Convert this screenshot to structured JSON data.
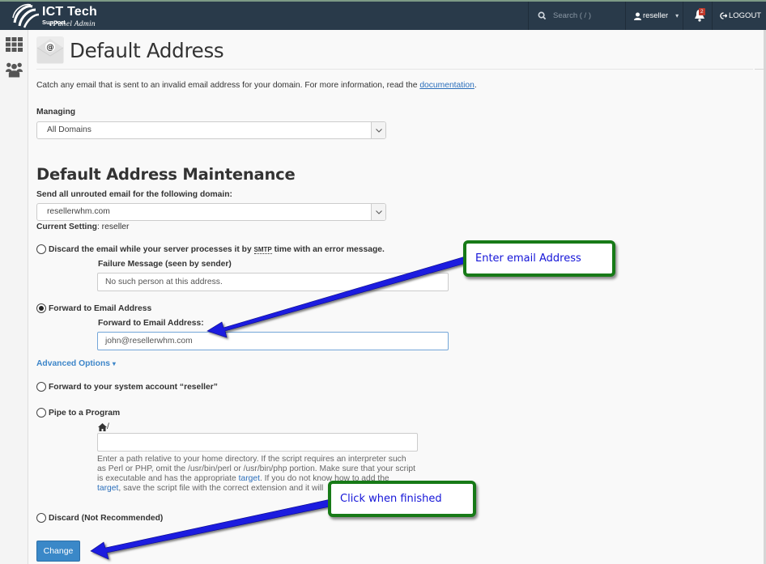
{
  "topbar": {
    "brand_main": "ICT Tech",
    "brand_sub": "Support",
    "brand_tag": "cPanel Admin",
    "search_placeholder": "Search ( / )",
    "username": "reseller",
    "notifications_count": "2",
    "logout_label": "LOGOUT"
  },
  "sidebar": {
    "items": [
      {
        "icon": "grid-icon",
        "label": "Home"
      },
      {
        "icon": "users-icon",
        "label": "Accounts"
      }
    ]
  },
  "page": {
    "title": "Default Address",
    "description_pre": "Catch any email that is sent to an invalid email address for your domain. For more information, read the ",
    "description_link": "documentation",
    "description_post": ".",
    "managing_label": "Managing",
    "managing_value": "All Domains",
    "section_title": "Default Address Maintenance",
    "domain_label": "Send all unrouted email for the following domain:",
    "domain_value": "resellerwhm.com",
    "current_setting_label": "Current Setting",
    "current_setting_value": ": reseller",
    "options": {
      "discard_pre": "Discard the email while your server processes it by ",
      "discard_abbr": "SMTP",
      "discard_post": " time with an error message.",
      "failure_label": "Failure Message (seen by sender)",
      "failure_value": "No such person at this address.",
      "forward_label": "Forward to Email Address",
      "forward_field_label": "Forward to Email Address:",
      "forward_value": "john@resellerwhm.com",
      "advanced_label": "Advanced Options",
      "advanced_caret": "▾",
      "system_account_label": "Forward to your system account “reseller”",
      "pipe_label": "Pipe to a Program",
      "pipe_prefix": "/",
      "pipe_value": "",
      "pipe_help_1": "Enter a path relative to your home directory. If the script requires an interpreter such as Perl or PHP, omit the /usr/bin/perl or /usr/bin/php portion. Make sure that your script is executable and has the appropriate ",
      "pipe_help_link1": "target",
      "pipe_help_2": ". If you do not know how to add the ",
      "pipe_help_link2": "target",
      "pipe_help_3": ", save the script file with the correct extension and it will",
      "blackhole_label": "Discard (Not Recommended)",
      "selected": "forward"
    },
    "submit_label": "Change"
  },
  "annotations": {
    "callout_email": "Enter email Address",
    "callout_finish": "Click when finished",
    "callout_border_color": "#177a17",
    "arrow_color": "#1a1adf"
  }
}
